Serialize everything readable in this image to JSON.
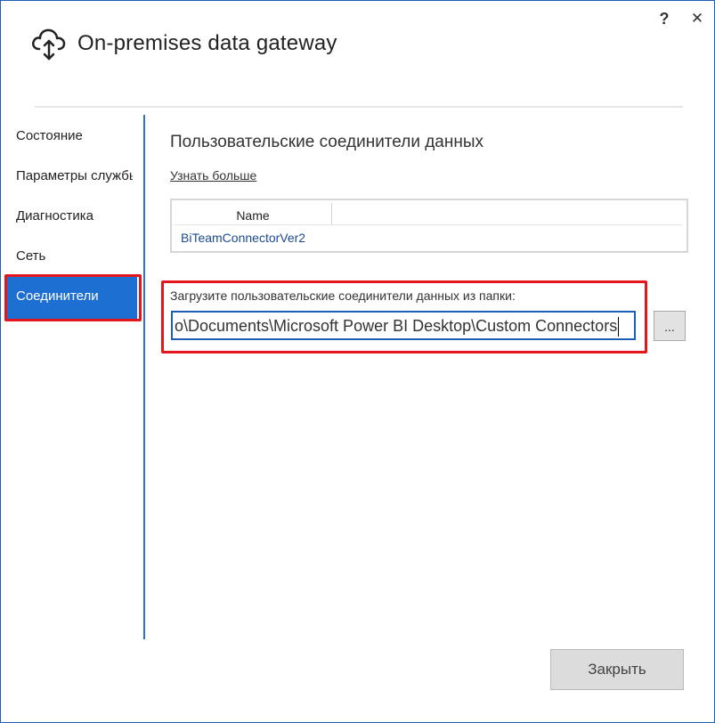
{
  "window": {
    "title": "On-premises data gateway",
    "help_label": "?",
    "close_label": "✕"
  },
  "sidebar": {
    "items": [
      {
        "label": "Состояние",
        "active": false
      },
      {
        "label": "Параметры службы",
        "active": false
      },
      {
        "label": "Диагностика",
        "active": false
      },
      {
        "label": "Сеть",
        "active": false
      },
      {
        "label": "Соединители",
        "active": true
      }
    ]
  },
  "content": {
    "title": "Пользовательские соединители данных",
    "learn_more": "Узнать больше",
    "grid": {
      "columns": [
        "Name"
      ],
      "rows": [
        "BiTeamConnectorVer2"
      ]
    },
    "folder_label": "Загрузите пользовательские соединители данных из папки:",
    "folder_path": "o\\Documents\\Microsoft Power BI Desktop\\Custom Connectors",
    "browse_label": "..."
  },
  "footer": {
    "close_button": "Закрыть"
  },
  "colors": {
    "accent": "#1e6fd2",
    "highlight": "#e3151d",
    "link": "#1a4a96"
  },
  "icons": {
    "app": "cloud-upload-icon"
  }
}
